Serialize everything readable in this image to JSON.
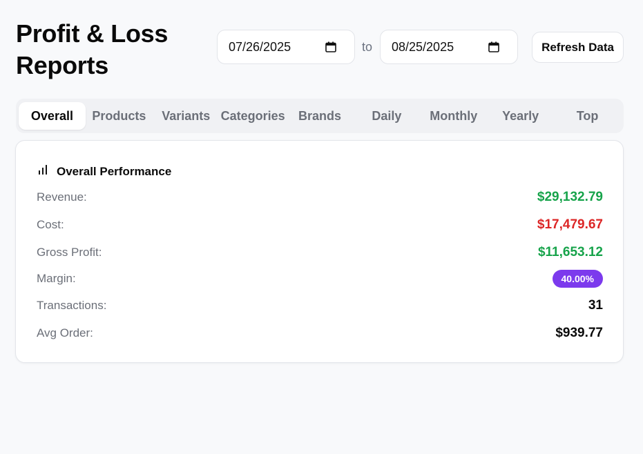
{
  "header": {
    "title": "Profit & Loss Reports",
    "date_from": "07/26/2025",
    "to_label": "to",
    "date_to": "08/25/2025",
    "refresh_label": "Refresh Data"
  },
  "tabs": [
    {
      "label": "Overall",
      "active": true
    },
    {
      "label": "Products",
      "active": false
    },
    {
      "label": "Variants",
      "active": false
    },
    {
      "label": "Categories",
      "active": false
    },
    {
      "label": "Brands",
      "active": false
    },
    {
      "label": "Daily",
      "active": false
    },
    {
      "label": "Monthly",
      "active": false
    },
    {
      "label": "Yearly",
      "active": false
    },
    {
      "label": "Top",
      "active": false
    }
  ],
  "card": {
    "icon": "bar-chart-icon",
    "title": "Overall Performance",
    "metrics": [
      {
        "label": "Revenue:",
        "value": "$29,132.79",
        "color": "#16a34a"
      },
      {
        "label": "Cost:",
        "value": "$17,479.67",
        "color": "#dc2626"
      },
      {
        "label": "Gross Profit:",
        "value": "$11,653.12",
        "color": "#16a34a"
      },
      {
        "label": "Margin:",
        "value": "40.00%",
        "badge_color": "#7c3aed"
      },
      {
        "label": "Transactions:",
        "value": "31"
      },
      {
        "label": "Avg Order:",
        "value": "$939.77"
      }
    ]
  }
}
